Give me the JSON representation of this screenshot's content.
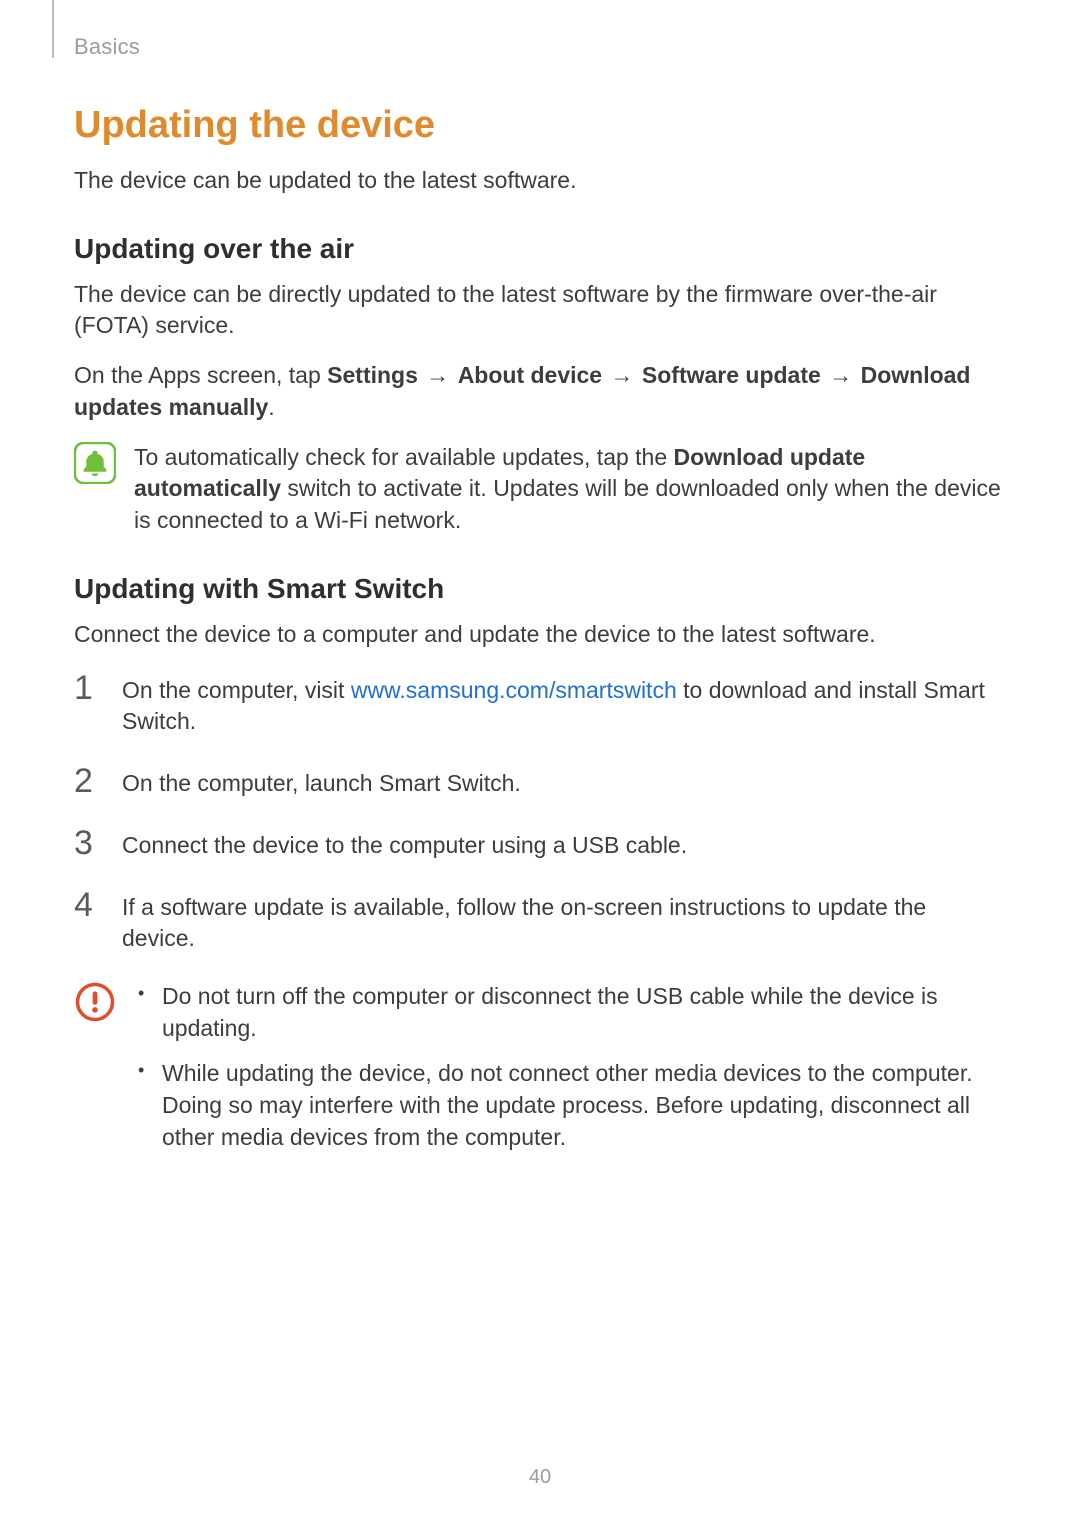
{
  "breadcrumb": "Basics",
  "h1": "Updating the device",
  "intro": "The device can be updated to the latest software.",
  "ota": {
    "heading": "Updating over the air",
    "p1": "The device can be directly updated to the latest software by the firmware over-the-air (FOTA) service.",
    "p2_pre": "On the Apps screen, tap ",
    "path_settings": "Settings",
    "arrow": "→",
    "path_about": "About device",
    "path_software_update": "Software update",
    "path_download": "Download updates manually",
    "period": ".",
    "note_pre": "To automatically check for available updates, tap the ",
    "note_bold": "Download update automatically",
    "note_post": " switch to activate it. Updates will be downloaded only when the device is connected to a Wi-Fi network."
  },
  "smartswitch": {
    "heading": "Updating with Smart Switch",
    "intro": "Connect the device to a computer and update the device to the latest software.",
    "steps": {
      "s1_num": "1",
      "s1_pre": "On the computer, visit ",
      "s1_link": "www.samsung.com/smartswitch",
      "s1_post": " to download and install Smart Switch.",
      "s2_num": "2",
      "s2": "On the computer, launch Smart Switch.",
      "s3_num": "3",
      "s3": "Connect the device to the computer using a USB cable.",
      "s4_num": "4",
      "s4": "If a software update is available, follow the on-screen instructions to update the device."
    },
    "caution": {
      "b1": "Do not turn off the computer or disconnect the USB cable while the device is updating.",
      "b2": "While updating the device, do not connect other media devices to the computer. Doing so may interfere with the update process. Before updating, disconnect all other media devices from the computer."
    }
  },
  "page_number": "40"
}
